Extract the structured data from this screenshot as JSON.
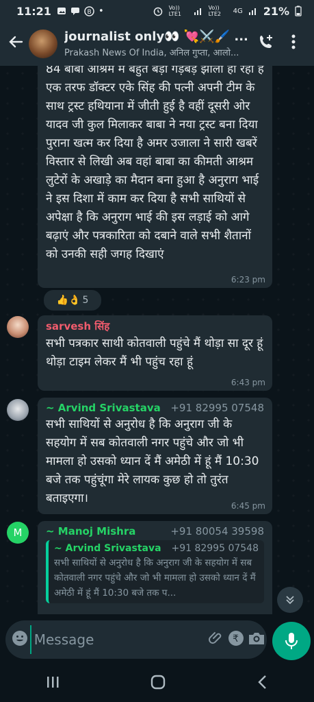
{
  "status": {
    "time": "11:21",
    "battery": "21%",
    "sim1": "Vo)) LTE1",
    "sim2": "Vo)) LTE2",
    "net": "4G"
  },
  "header": {
    "title": "journalist only👀 💘⚔️🖌️ ...",
    "subtitle": "Prakash News Of India, अनिल गुप्ता, आलो..."
  },
  "messages": [
    {
      "text": "84 बाबा आश्रम में बहुत बड़ा गड़बड़ झाला हो रहा है एक तरफ डॉक्टर एके सिंह की पत्नी अपनी टीम के साथ ट्रस्ट हथियाना में जीती हुई है वहीं दूसरी ओर यादव जी कुल मिलाकर बाबा ने नया ट्रस्ट बना दिया पुराना खत्म कर दिया है अमर उजाला ने सारी खबरें विस्तार से लिखी अब वहां बाबा का कीमती आश्रम लुटेरों के अखाड़े का मैदान बना हुआ है अनुराग भाई ने इस दिशा में काम कर दिया है सभी साथियों से अपेक्षा है कि अनुराग भाई की इस लड़ाई को आगे बढ़ाएं और पत्रकारिता को दबाने वाले सभी शैतानों को उनकी सही जगह दिखाएं",
      "time": "6:23 pm",
      "reactions": "👍👌",
      "reaction_count": "5"
    },
    {
      "sender": "sarvesh सिंह",
      "sender_color": "#f15c6d",
      "text": "सभी पत्रकार साथी कोतवाली पहुंचे मैं थोड़ा सा दूर हूं थोड़ा टाइम लेकर मैं भी पहुंच रहा हूं",
      "time": "6:43 pm"
    },
    {
      "sender": "~ Arvind Srivastava",
      "sender_color": "#25d366",
      "phone": "+91 82995 07548",
      "text": "सभी साथियों से अनुरोध है कि अनुराग जी के सहयोग में सब कोतवाली नगर पहुंचे और जो भी मामला हो उसको ध्यान दें मैं अमेठी में हूं मैं 10:30 बजे तक पहुंचूंगा मेरे लायक कुछ हो तो तुरंत बताइएगा।",
      "time": "6:45 pm"
    },
    {
      "sender": "~ Manoj Mishra",
      "sender_color": "#25d366",
      "phone": "+91 80054 39598",
      "avatar_letter": "M",
      "quote": {
        "sender": "~ Arvind Srivastava",
        "phone": "+91 82995 07548",
        "text": "सभी साथियों से अनुरोध है कि अनुराग जी के सहयोग में सब कोतवाली नगर पहुंचे और जो भी मामला हो उसको ध्यान दें मैं अमेठी में हूं मैं 10:30 बजे तक प..."
      }
    }
  ],
  "composer": {
    "placeholder": "Message"
  },
  "colors": {
    "accent": "#00a884",
    "bubble": "#202c33",
    "bg": "#0b141a"
  },
  "icons": [
    "back-arrow-icon",
    "add-call-icon",
    "more-options-icon",
    "emoji-icon",
    "attach-icon",
    "rupee-payment-icon",
    "camera-icon",
    "mic-icon",
    "scroll-down-icon",
    "recents-icon",
    "home-icon",
    "nav-back-icon"
  ]
}
